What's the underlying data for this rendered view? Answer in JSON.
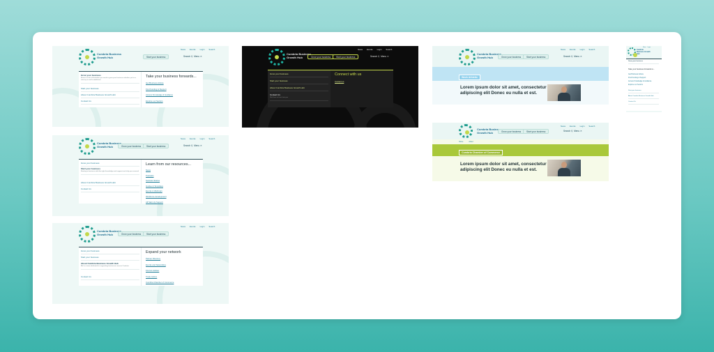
{
  "header": {
    "logo_text": "Cumbria Business Growth Hub",
    "grow_label": "Grow your business",
    "start_label": "Start your business",
    "links": [
      "News",
      "Events",
      "Login",
      "Search"
    ],
    "search_label": "Search",
    "menu_label": "Menu"
  },
  "menus": [
    {
      "items": [
        {
          "label": "Grow your business",
          "desc": "Access to the information you need to grow your business whether you're a start-up or well established",
          "active": true
        },
        {
          "label": "Start your business",
          "active": false
        },
        {
          "label": "About Cumbria Business Growth Hub",
          "active": false
        },
        {
          "label": "Contact Us",
          "active": false
        }
      ],
      "title": "Take your business forwards...",
      "links": [
        "Get Business Advice",
        "Find Funding & Support",
        "Access Knowledge & Guidance",
        "Explore our Sectors"
      ]
    },
    {
      "items": [
        {
          "label": "Grow your business",
          "active": false
        },
        {
          "label": "Start your business",
          "desc": "Starting a business with the right knowledge and support can help you succeed",
          "active": true
        },
        {
          "label": "About Cumbria Business Growth Hub",
          "active": false
        },
        {
          "label": "Contact Us",
          "active": false
        }
      ],
      "title": "Learn from our resources...",
      "links": [
        "News",
        "Podcasts",
        "Success Stories",
        "Guides & Templates",
        "Events & Webinars",
        "Workforce development",
        "All Start-Up Support"
      ]
    },
    {
      "items": [
        {
          "label": "Grow your business",
          "active": false
        },
        {
          "label": "Start your business",
          "active": false
        },
        {
          "label": "About Cumbria Business Growth Hub",
          "desc": "We're a team dedicated to supporting businesses across Cumbria",
          "active": true
        },
        {
          "label": "Contact Us",
          "active": false
        }
      ],
      "title": "Expand your network",
      "links": [
        "Partner Directory",
        "Events and Networking",
        "Find an Adviser",
        "Trade Advice",
        "Cumbria Chamber of Commerce"
      ]
    }
  ],
  "dark_menu": {
    "items": [
      "Grow your business",
      "Start your business",
      "About Cumbria Business Growth Hub",
      "Contact Us"
    ],
    "contact_desc": "We'd love to hear from you",
    "title": "Connect with us",
    "link": "Contact us"
  },
  "banners": [
    {
      "label": "Work Athletic",
      "text": "Lorem ipsum dolor sit amet, consectetur adipiscing elit Donec eu nulla et est.",
      "color": "#bfe4f4"
    },
    {
      "label": "Cumbria Chamber of Commerce",
      "text": "Lorem ipsum dolor sit amet, consectetur adipiscing elit Donec eu nulla et est.",
      "color": "#a9c83a"
    }
  ],
  "crumbs": [
    "Home",
    "About"
  ],
  "mobile": {
    "items": [
      "Grow your business",
      "Start your business",
      "About Cumbria Business Growth Hub",
      "Contact Us"
    ],
    "title": "Take your business forwards to...",
    "links": [
      "Get Business Advice",
      "Find Funding & Support",
      "Access Knowledge & Guidance",
      "Explore our Sectors"
    ]
  },
  "colors": {
    "teal": "#1f9c8e",
    "lime": "#c6d94b",
    "navy": "#1b4b5a"
  }
}
